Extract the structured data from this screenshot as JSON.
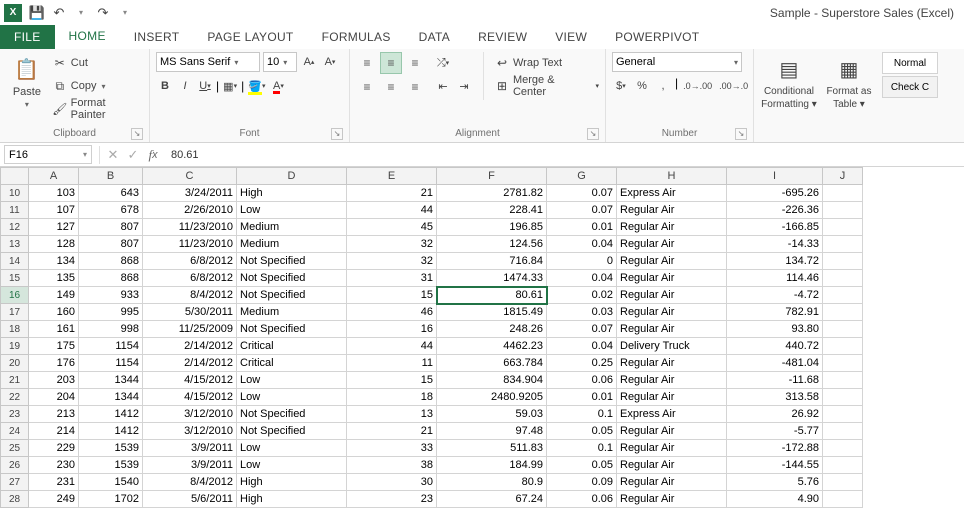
{
  "titlebar": {
    "title": "Sample - Superstore Sales (Excel)"
  },
  "qat": {
    "save": "💾",
    "undo": "↶",
    "redo": "↷"
  },
  "tabs": [
    "FILE",
    "HOME",
    "INSERT",
    "PAGE LAYOUT",
    "FORMULAS",
    "DATA",
    "REVIEW",
    "VIEW",
    "POWERPIVOT"
  ],
  "clipboard": {
    "paste": "Paste",
    "cut": "Cut",
    "copy": "Copy",
    "format_painter": "Format Painter",
    "label": "Clipboard"
  },
  "font": {
    "name": "MS Sans Serif",
    "size": "10",
    "label": "Font"
  },
  "alignment": {
    "wrap": "Wrap Text",
    "merge": "Merge & Center",
    "label": "Alignment"
  },
  "number": {
    "format": "General",
    "label": "Number"
  },
  "styles": {
    "cond": "Conditional Formatting",
    "cond1": "Conditional",
    "cond2": "Formatting",
    "table": "Format as",
    "table2": "Table",
    "normal": "Normal",
    "check": "Check C"
  },
  "namebox": "F16",
  "formula_value": "80.61",
  "columns": [
    "A",
    "B",
    "C",
    "D",
    "E",
    "F",
    "G",
    "H",
    "I",
    "J"
  ],
  "rows": [
    {
      "n": 10,
      "a": "103",
      "b": "643",
      "c": "3/24/2011",
      "d": "High",
      "e": "21",
      "f": "2781.82",
      "g": "0.07",
      "h": "Express Air",
      "i": "-695.26"
    },
    {
      "n": 11,
      "a": "107",
      "b": "678",
      "c": "2/26/2010",
      "d": "Low",
      "e": "44",
      "f": "228.41",
      "g": "0.07",
      "h": "Regular Air",
      "i": "-226.36"
    },
    {
      "n": 12,
      "a": "127",
      "b": "807",
      "c": "11/23/2010",
      "d": "Medium",
      "e": "45",
      "f": "196.85",
      "g": "0.01",
      "h": "Regular Air",
      "i": "-166.85"
    },
    {
      "n": 13,
      "a": "128",
      "b": "807",
      "c": "11/23/2010",
      "d": "Medium",
      "e": "32",
      "f": "124.56",
      "g": "0.04",
      "h": "Regular Air",
      "i": "-14.33"
    },
    {
      "n": 14,
      "a": "134",
      "b": "868",
      "c": "6/8/2012",
      "d": "Not Specified",
      "e": "32",
      "f": "716.84",
      "g": "0",
      "h": "Regular Air",
      "i": "134.72"
    },
    {
      "n": 15,
      "a": "135",
      "b": "868",
      "c": "6/8/2012",
      "d": "Not Specified",
      "e": "31",
      "f": "1474.33",
      "g": "0.04",
      "h": "Regular Air",
      "i": "114.46"
    },
    {
      "n": 16,
      "a": "149",
      "b": "933",
      "c": "8/4/2012",
      "d": "Not Specified",
      "e": "15",
      "f": "80.61",
      "g": "0.02",
      "h": "Regular Air",
      "i": "-4.72"
    },
    {
      "n": 17,
      "a": "160",
      "b": "995",
      "c": "5/30/2011",
      "d": "Medium",
      "e": "46",
      "f": "1815.49",
      "g": "0.03",
      "h": "Regular Air",
      "i": "782.91"
    },
    {
      "n": 18,
      "a": "161",
      "b": "998",
      "c": "11/25/2009",
      "d": "Not Specified",
      "e": "16",
      "f": "248.26",
      "g": "0.07",
      "h": "Regular Air",
      "i": "93.80"
    },
    {
      "n": 19,
      "a": "175",
      "b": "1154",
      "c": "2/14/2012",
      "d": "Critical",
      "e": "44",
      "f": "4462.23",
      "g": "0.04",
      "h": "Delivery Truck",
      "i": "440.72"
    },
    {
      "n": 20,
      "a": "176",
      "b": "1154",
      "c": "2/14/2012",
      "d": "Critical",
      "e": "11",
      "f": "663.784",
      "g": "0.25",
      "h": "Regular Air",
      "i": "-481.04"
    },
    {
      "n": 21,
      "a": "203",
      "b": "1344",
      "c": "4/15/2012",
      "d": "Low",
      "e": "15",
      "f": "834.904",
      "g": "0.06",
      "h": "Regular Air",
      "i": "-11.68"
    },
    {
      "n": 22,
      "a": "204",
      "b": "1344",
      "c": "4/15/2012",
      "d": "Low",
      "e": "18",
      "f": "2480.9205",
      "g": "0.01",
      "h": "Regular Air",
      "i": "313.58"
    },
    {
      "n": 23,
      "a": "213",
      "b": "1412",
      "c": "3/12/2010",
      "d": "Not Specified",
      "e": "13",
      "f": "59.03",
      "g": "0.1",
      "h": "Express Air",
      "i": "26.92"
    },
    {
      "n": 24,
      "a": "214",
      "b": "1412",
      "c": "3/12/2010",
      "d": "Not Specified",
      "e": "21",
      "f": "97.48",
      "g": "0.05",
      "h": "Regular Air",
      "i": "-5.77"
    },
    {
      "n": 25,
      "a": "229",
      "b": "1539",
      "c": "3/9/2011",
      "d": "Low",
      "e": "33",
      "f": "511.83",
      "g": "0.1",
      "h": "Regular Air",
      "i": "-172.88"
    },
    {
      "n": 26,
      "a": "230",
      "b": "1539",
      "c": "3/9/2011",
      "d": "Low",
      "e": "38",
      "f": "184.99",
      "g": "0.05",
      "h": "Regular Air",
      "i": "-144.55"
    },
    {
      "n": 27,
      "a": "231",
      "b": "1540",
      "c": "8/4/2012",
      "d": "High",
      "e": "30",
      "f": "80.9",
      "g": "0.09",
      "h": "Regular Air",
      "i": "5.76"
    },
    {
      "n": 28,
      "a": "249",
      "b": "1702",
      "c": "5/6/2011",
      "d": "High",
      "e": "23",
      "f": "67.24",
      "g": "0.06",
      "h": "Regular Air",
      "i": "4.90"
    }
  ],
  "active_row": 16
}
